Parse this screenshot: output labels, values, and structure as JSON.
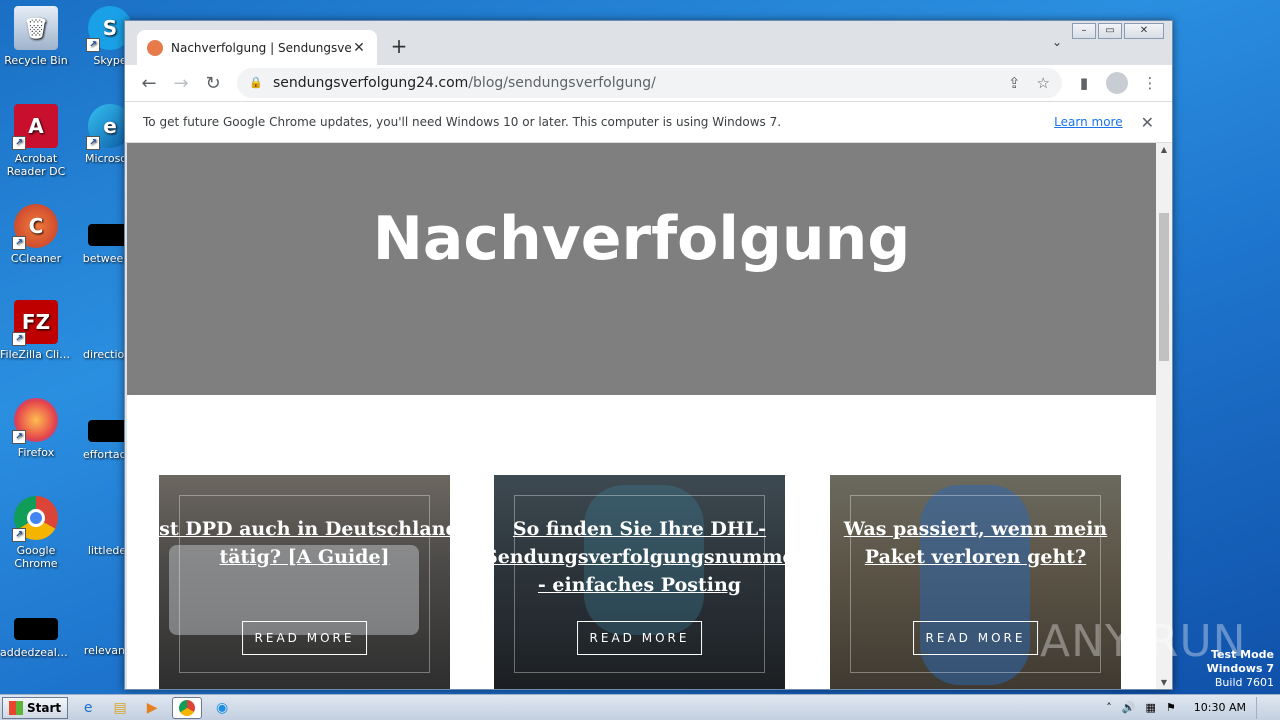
{
  "desktop": {
    "icons": [
      {
        "label": "Recycle Bin"
      },
      {
        "label": "Skype"
      },
      {
        "label": "Acrobat Reader DC"
      },
      {
        "label": "Microsoft"
      },
      {
        "label": "CCleaner"
      },
      {
        "label": "betweeng"
      },
      {
        "label": "FileZilla Client"
      },
      {
        "label": "directions"
      },
      {
        "label": "Firefox"
      },
      {
        "label": "effortacth"
      },
      {
        "label": "Google Chrome"
      },
      {
        "label": "littledec"
      },
      {
        "label": "addedzeala..."
      },
      {
        "label": "relevante"
      }
    ]
  },
  "browser": {
    "tab_title": "Nachverfolgung | Sendungsverfolgu",
    "new_tab_symbol": "+",
    "url_host": "sendungsverfolgung24.com",
    "url_path": "/blog/sendungsverfolgung/",
    "infobar_text": "To get future Google Chrome updates, you'll need Windows 10 or later. This computer is using Windows 7.",
    "infobar_link": "Learn more"
  },
  "page": {
    "hero_title": "Nachverfolgung",
    "cards": [
      {
        "title": "Ist DPD auch in Deutschland tätig? [A Guide]",
        "button": "READ MORE",
        "bg": "#4d4b49"
      },
      {
        "title": "So finden Sie Ihre DHL-Sendungsverfolgungsnummer - einfaches Posting",
        "button": "READ MORE",
        "bg": "#2a3238"
      },
      {
        "title": "Was passiert, wenn mein Paket verloren geht?",
        "button": "READ MORE",
        "bg": "#5b5446"
      }
    ]
  },
  "watermark": "ANY RUN",
  "test_mode": {
    "line1": "Test Mode",
    "line2": "Windows 7",
    "line3": "Build 7601"
  },
  "taskbar": {
    "start_label": "Start",
    "clock": "10:30 AM"
  }
}
